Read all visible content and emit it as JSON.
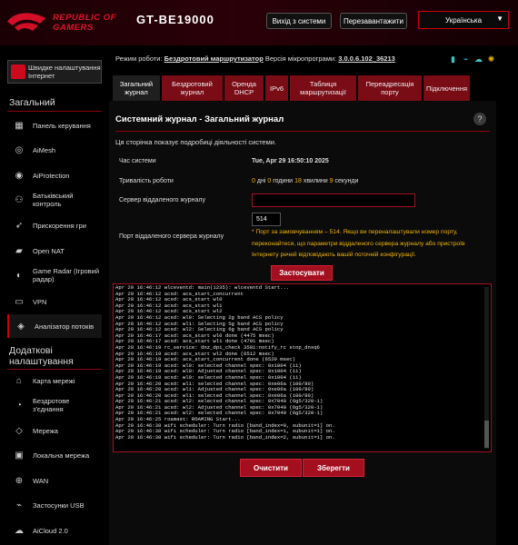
{
  "header": {
    "brand_line1": "REPUBLIC OF",
    "brand_line2": "GAMERS",
    "model": "GT-BE19000",
    "logout_label": "Вихід з системи",
    "reboot_label": "Перезавантажити",
    "language": "Українська"
  },
  "sidebar": {
    "quick_setup": "Швидке налаштування Інтернет",
    "general_title": "Загальний",
    "general_items": [
      {
        "label": "Панель керування",
        "icon": "dashboard-icon"
      },
      {
        "label": "AiMesh",
        "icon": "mesh-icon"
      },
      {
        "label": "AiProtection",
        "icon": "shield-icon"
      },
      {
        "label": "Батьківський контроль",
        "icon": "parental-icon"
      },
      {
        "label": "Прискорення гри",
        "icon": "rocket-icon"
      },
      {
        "label": "Open NAT",
        "icon": "nat-icon"
      },
      {
        "label": "Game Radar (Ігровий радар)",
        "icon": "radar-icon"
      },
      {
        "label": "VPN",
        "icon": "vpn-icon"
      },
      {
        "label": "Аналізатор потоків",
        "icon": "analyzer-icon"
      }
    ],
    "advanced_title": "Додаткові налаштування",
    "advanced_items": [
      {
        "label": "Карта мережі",
        "icon": "map-icon"
      },
      {
        "label": "Бездротове з'єднання",
        "icon": "wireless-icon"
      },
      {
        "label": "Мережа",
        "icon": "network-icon"
      },
      {
        "label": "Локальна мережа",
        "icon": "lan-icon"
      },
      {
        "label": "WAN",
        "icon": "globe-icon"
      },
      {
        "label": "Застосунки USB",
        "icon": "usb-icon"
      },
      {
        "label": "AiCloud 2.0",
        "icon": "cloud-icon"
      }
    ]
  },
  "status": {
    "mode_label": "Режим роботи:",
    "mode_value": "Бездротовий маршрутизатор",
    "fw_label": "Версія мікропрограми:",
    "fw_value": "3.0.0.6.102_36213"
  },
  "tabs": [
    "Загальний журнал",
    "Бездротовий журнал",
    "Оренда DHCP",
    "IPv6",
    "Таблиця маршрутизації",
    "Переадресація порту",
    "Підключення"
  ],
  "panel": {
    "title": "Системний журнал - Загальний журнал",
    "description": "Ця сторінка показує подробиці діяльності системи.",
    "system_time_label": "Час системи",
    "system_time_value": "Tue, Apr 29 16:50:10 2025",
    "uptime_label": "Тривалість роботи",
    "uptime": {
      "days": "0",
      "days_word": "дні",
      "hours": "0",
      "hours_word": "години",
      "minutes": "18",
      "minutes_word": "хвилини",
      "seconds": "9",
      "seconds_word": "секунди"
    },
    "remote_server_label": "Сервер віддаленого журналу",
    "remote_server_value": "",
    "remote_port_label": "Порт віддаленого сервера журналу",
    "remote_port_value": "514",
    "port_note": "* Порт за замовчуванням – 514. Якщо ви переналаштували номер порту, переконайтеся, що параметри віддаленого сервера журналу або пристроїв Інтернету речей відповідають вашій поточній конфігурації.",
    "apply_label": "Застосувати",
    "clear_label": "Очистити",
    "save_label": "Зберегти",
    "log_text": "Apr 29 16:46:12 wlceventd: main(1235): wlceventd Start...\nApr 29 16:46:12 acsd: acs_start_concurrent\nApr 29 16:46:12 acsd: acs_start wl0\nApr 29 16:46:12 acsd: acs_start wl1\nApr 29 16:46:12 acsd: acs_start wl2\nApr 29 16:46:12 acsd: wl0: Selecting 2g band ACS policy\nApr 29 16:46:12 acsd: wl1: Selecting 5g band ACS policy\nApr 29 16:46:12 acsd: wl2: Selecting 6g band ACS policy\nApr 29 16:46:17 acsd: acs_start wl0 done (4475 msec)\nApr 29 16:46:17 acsd: acs_start wl1 done (4701 msec)\nApr 29 16:46:19 rc_service: dnz_dpi_check 3501:notify_rc stop_dnsq6\nApr 29 16:46:19 acsd: acs_start wl2 done (6512 msec)\nApr 29 16:46:19 acsd: acs_start_concurrent done (6520 msec)\nApr 29 16:46:19 acsd: wl0: selected channel spec: 0x1004 (11)\nApr 29 16:46:19 acsd: wl0: Adjusted channel spec: 0x1004 (11)\nApr 29 16:46:19 acsd: wl0: selected channel spec: 0x1004 (11)\nApr 29 16:46:20 acsd: wl1: selected channel spec: 0xe06a (100/80)\nApr 29 16:46:20 acsd: wl1: Adjusted channel spec: 0xe06a (100/80)\nApr 29 16:46:20 acsd: wl1: selected channel spec: 0xe06a (100/80)\nApr 29 16:46:21 acsd: wl2: selected channel spec: 0x7040 (6g5/320-1)\nApr 29 16:46:21 acsd: wl2: Adjusted channel spec: 0x7040 (6g5/320-1)\nApr 29 16:46:21 acsd: wl2: selected channel spec: 0x7040 (6g5/320-1)\nApr 29 16:46:25 roamast: ROAMING Start...\nApr 29 16:46:38 wifi scheduler: Turn radio [band_index=0, subunit=1] on.\nApr 29 16:46:38 wifi scheduler: Turn radio [band_index=1, subunit=1] on.\nApr 29 16:46:38 wifi scheduler: Turn radio [band_index=2, subunit=1] on."
  },
  "colors": {
    "accent": "#a30f1f",
    "note": "#f0b400",
    "tab": "#7a0c16"
  }
}
